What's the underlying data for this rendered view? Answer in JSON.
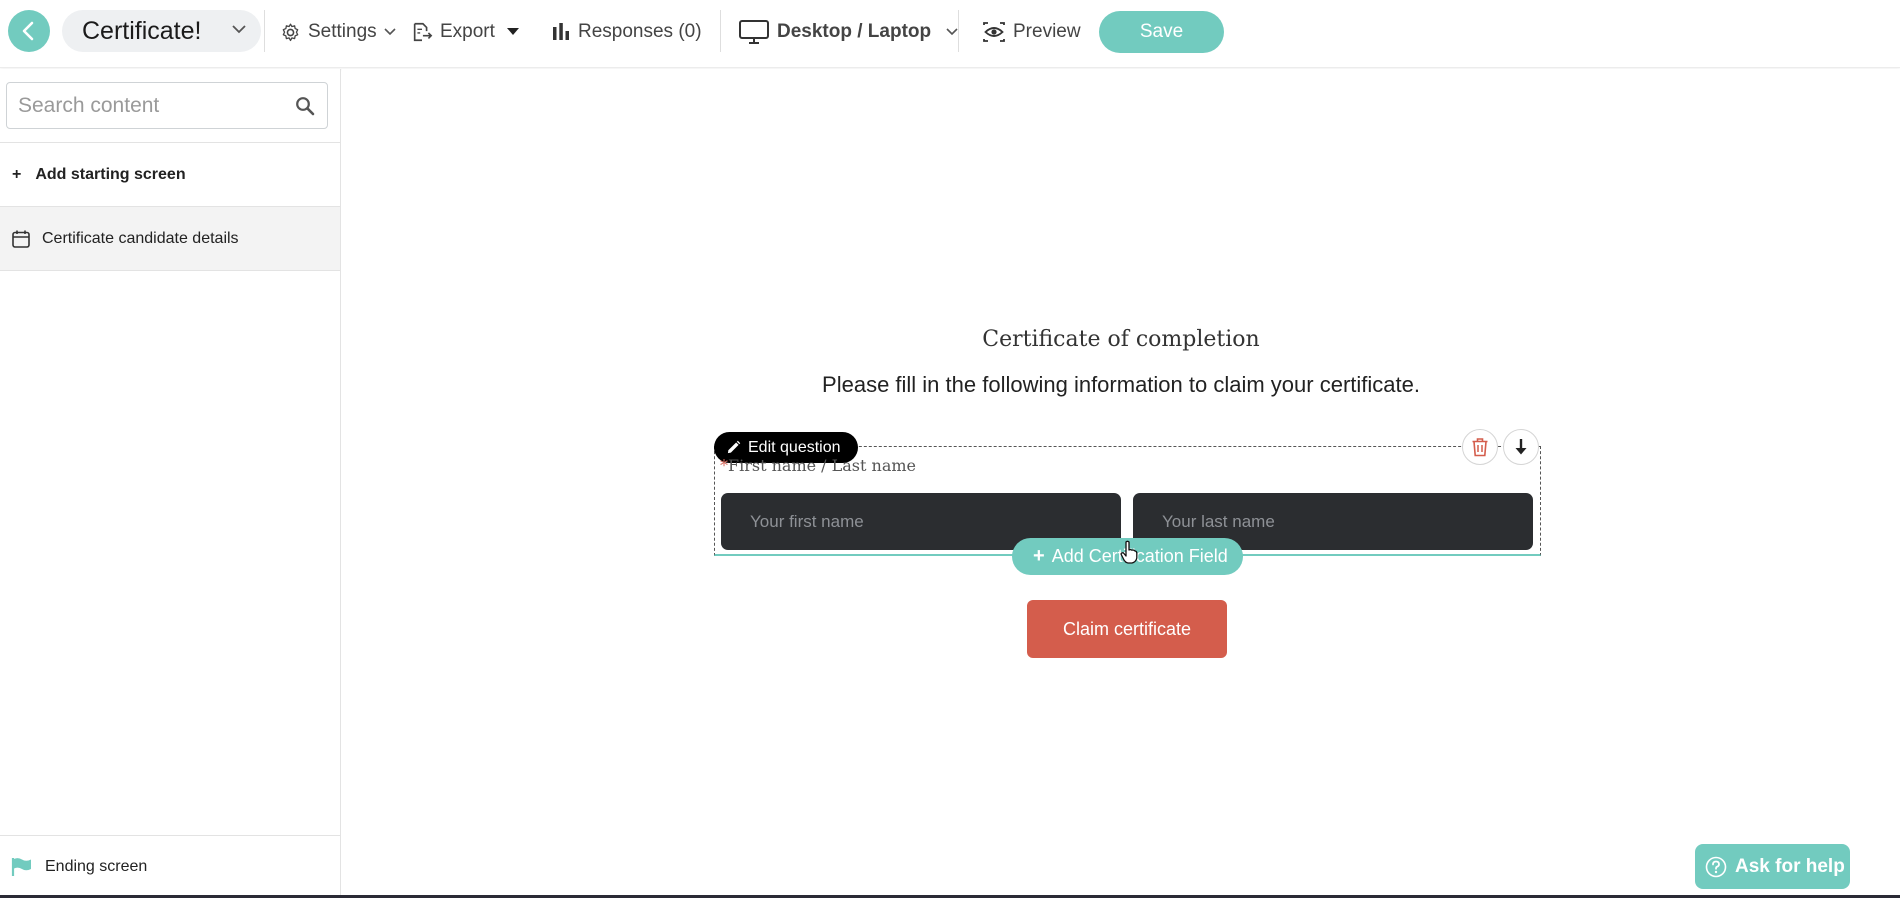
{
  "header": {
    "title": "Certificate!",
    "settings_label": "Settings",
    "export_label": "Export",
    "responses_label": "Responses (0)",
    "device_label": "Desktop / Laptop",
    "preview_label": "Preview",
    "save_label": "Save"
  },
  "sidebar": {
    "search_placeholder": "Search content",
    "add_starting_label": "Add starting screen",
    "items": [
      {
        "label": "Certificate candidate details",
        "icon": "calendar-icon"
      }
    ],
    "ending_label": "Ending screen"
  },
  "canvas": {
    "title": "Certificate of completion",
    "subtitle": "Please fill in the following information to claim your certificate.",
    "edit_question_label": "Edit question",
    "question_required_mark": "*",
    "question_label": "First name / Last name",
    "first_name_placeholder": "Your first name",
    "last_name_placeholder": "Your last name",
    "add_field_label": "Add Certification Field",
    "claim_label": "Claim certificate"
  },
  "help": {
    "label": "Ask for help"
  },
  "colors": {
    "accent": "#72cbbf",
    "claim": "#d45d4c",
    "input_bg": "#2b2d30"
  }
}
